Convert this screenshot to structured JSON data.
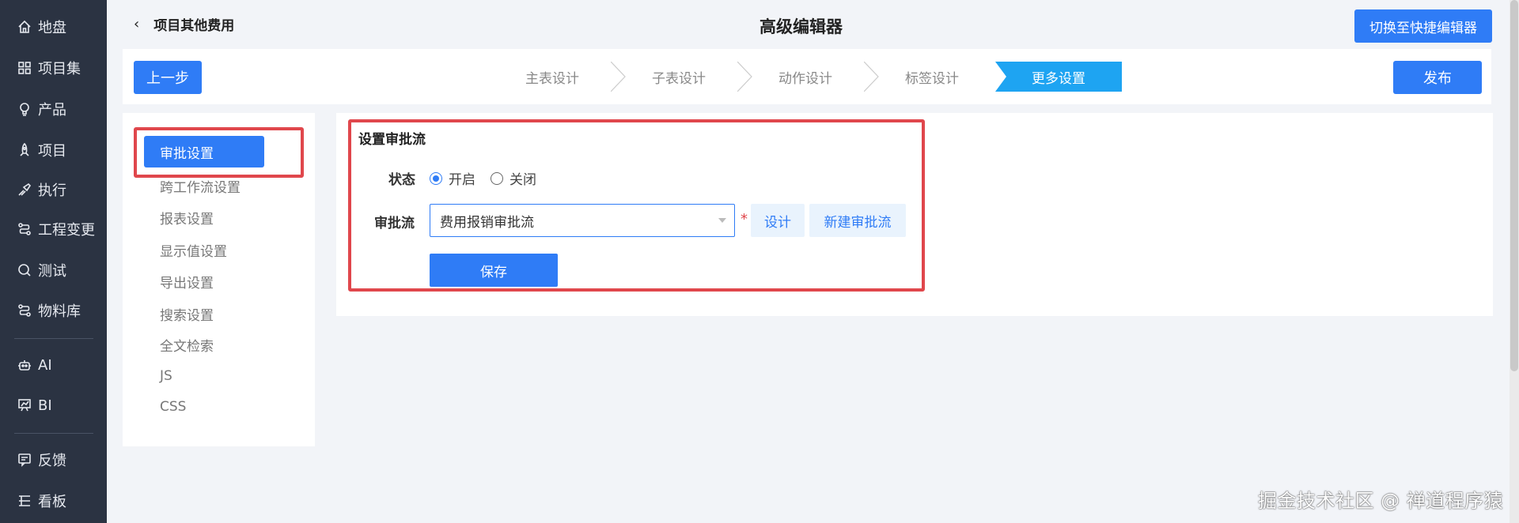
{
  "nav": {
    "items": [
      {
        "label": "地盘",
        "icon": "home-icon"
      },
      {
        "label": "项目集",
        "icon": "grid-icon"
      },
      {
        "label": "产品",
        "icon": "lightbulb-icon"
      },
      {
        "label": "项目",
        "icon": "rocket-icon"
      },
      {
        "label": "执行",
        "icon": "run-icon"
      },
      {
        "label": "工程变更",
        "icon": "flow-icon"
      },
      {
        "label": "测试",
        "icon": "search-circle-icon"
      },
      {
        "label": "物料库",
        "icon": "flow-icon"
      },
      {
        "label": "AI",
        "icon": "robot-icon"
      },
      {
        "label": "BI",
        "icon": "chart-board-icon"
      },
      {
        "label": "反馈",
        "icon": "feedback-icon"
      },
      {
        "label": "看板",
        "icon": "kanban-icon"
      }
    ]
  },
  "header": {
    "back_label": "项目其他费用",
    "title": "高级编辑器",
    "switch_label": "切换至快捷编辑器"
  },
  "stepbar": {
    "prev_label": "上一步",
    "publish_label": "发布",
    "steps": [
      "主表设计",
      "子表设计",
      "动作设计",
      "标签设计",
      "更多设置"
    ],
    "active_index": 4
  },
  "settings_menu": {
    "active": "审批设置",
    "items": [
      "跨工作流设置",
      "报表设置",
      "显示值设置",
      "导出设置",
      "搜索设置",
      "全文检索",
      "JS",
      "CSS"
    ]
  },
  "approval": {
    "section_title": "设置审批流",
    "status_label": "状态",
    "status_on": "开启",
    "status_off": "关闭",
    "status_value": "开启",
    "flow_label": "审批流",
    "flow_value": "费用报销审批流",
    "required_mark": "*",
    "design_label": "设计",
    "new_flow_label": "新建审批流",
    "save_label": "保存"
  },
  "watermark": "掘金技术社区 @ 禅道程序猿",
  "colors": {
    "primary": "#2f7cf6",
    "step_active": "#1ea4f2",
    "nav_bg": "#2b3342",
    "highlight": "#e0474c"
  }
}
